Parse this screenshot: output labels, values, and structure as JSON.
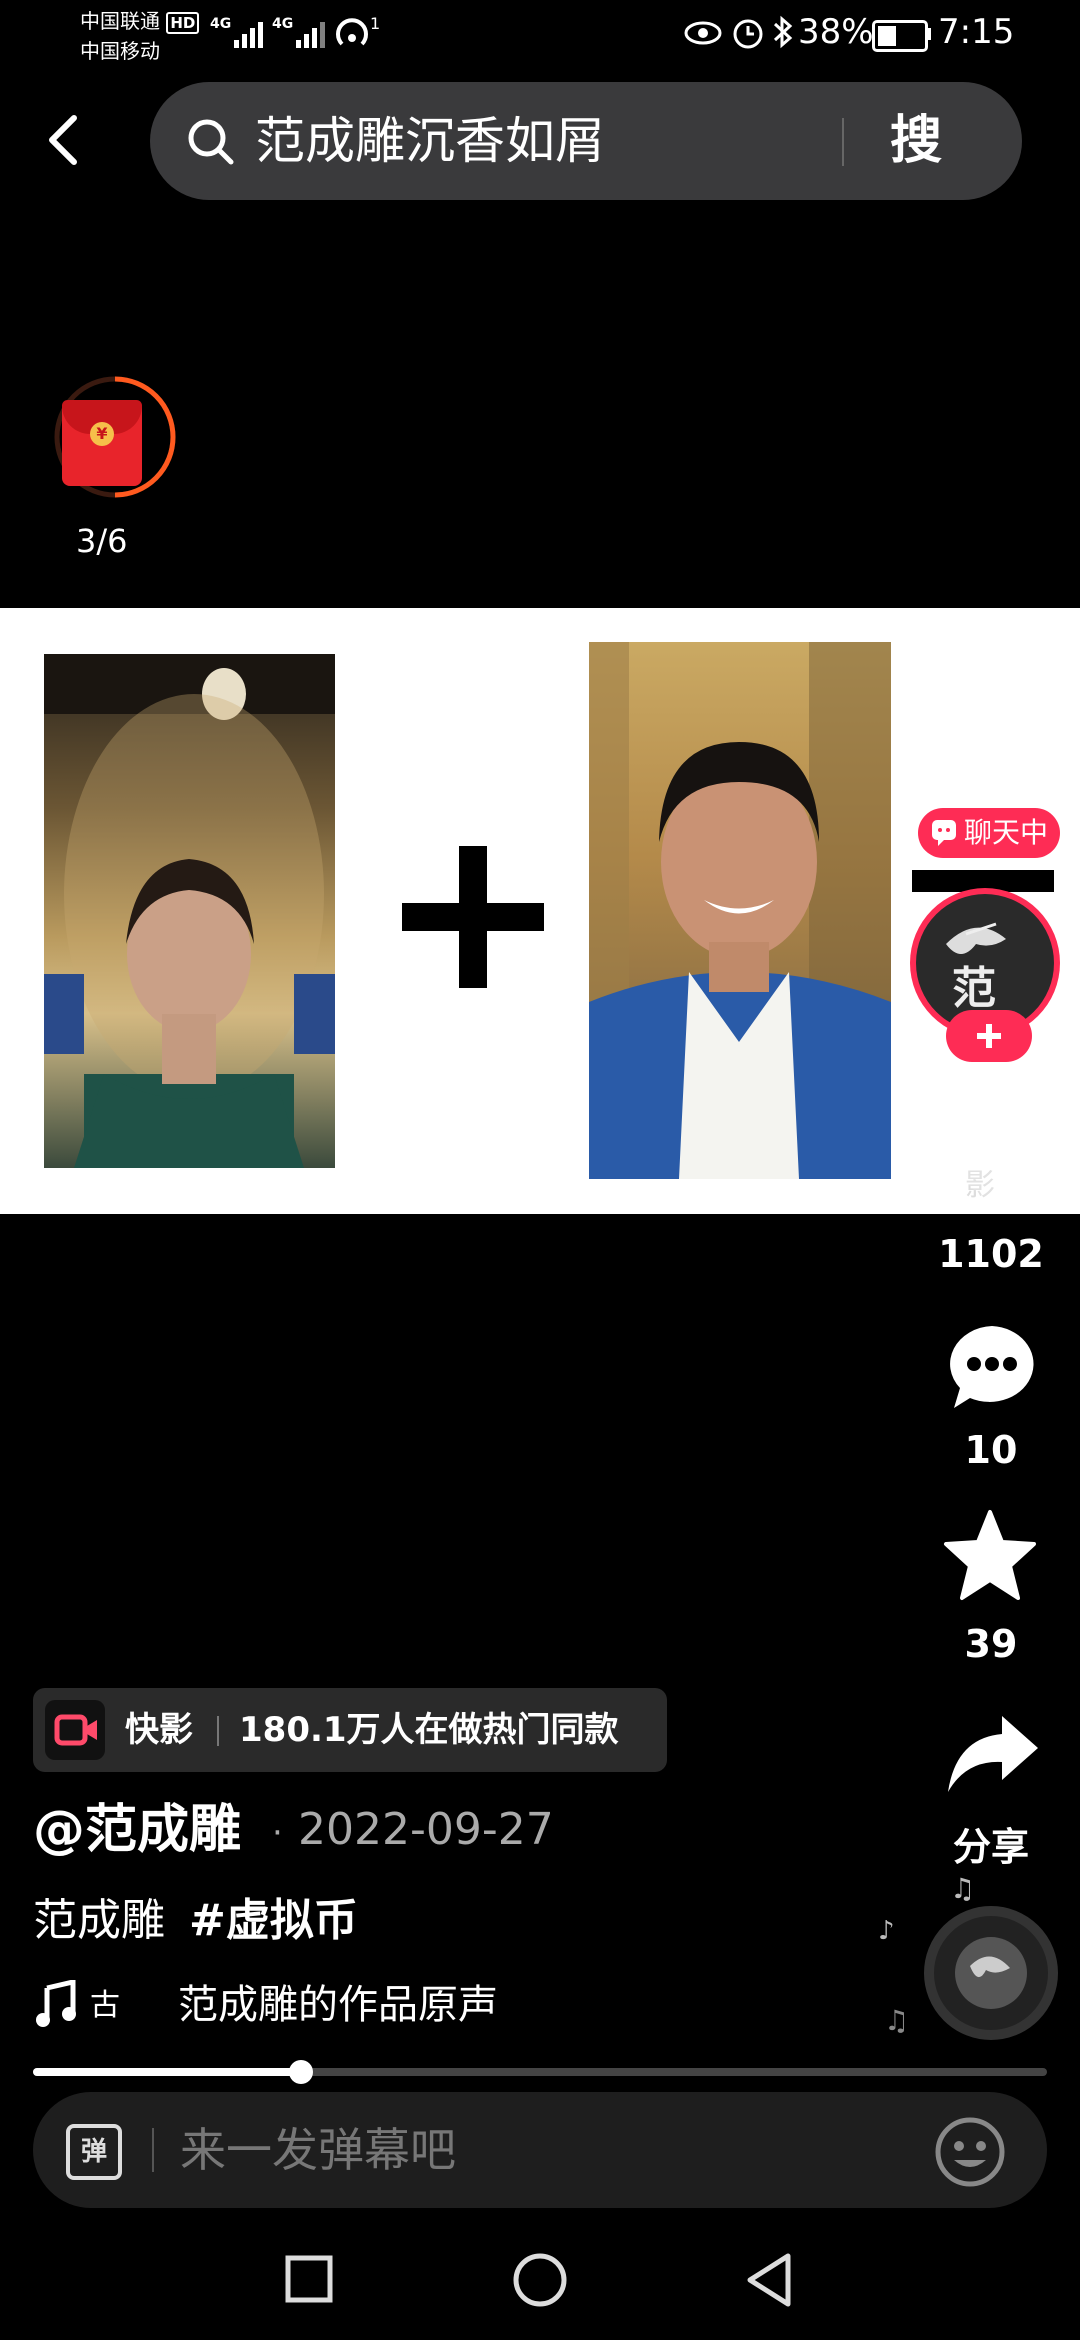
{
  "status": {
    "carrier1": "中国联通",
    "carrier2": "中国移动",
    "hd": "HD",
    "net1": "4G",
    "net2": "4G",
    "hotspot_sup": "1",
    "battery": "38%",
    "time": "7:15"
  },
  "search": {
    "query": "范成雕沉香如屑",
    "button": "搜"
  },
  "redpacket": {
    "progress_text": "3/6",
    "progress_fraction": 0.5
  },
  "video": {
    "plus_sign": "+",
    "watermark": "影"
  },
  "creator": {
    "chat_badge": "聊天中",
    "avatar_char": "范"
  },
  "actions": {
    "like_count": "1102",
    "comment_count": "10",
    "favorite_count": "39",
    "share_label": "分享"
  },
  "promo": {
    "app": "快影",
    "text": "180.1万人在做热门同款"
  },
  "post": {
    "author": "@范成雕",
    "dot": "·",
    "date": "2022-09-27",
    "caption_plain": "范成雕",
    "hashtag": "#虚拟币",
    "music_tag": "古",
    "music": "范成雕的作品原声"
  },
  "playback": {
    "progress_fraction": 0.25
  },
  "danmu": {
    "icon_text": "弹",
    "placeholder": "来一发弹幕吧"
  },
  "colors": {
    "accent": "#fe2c55",
    "chat_badge": "#fe2c55",
    "redpacket": "#e8242b",
    "ring": "#ff5a1f"
  }
}
